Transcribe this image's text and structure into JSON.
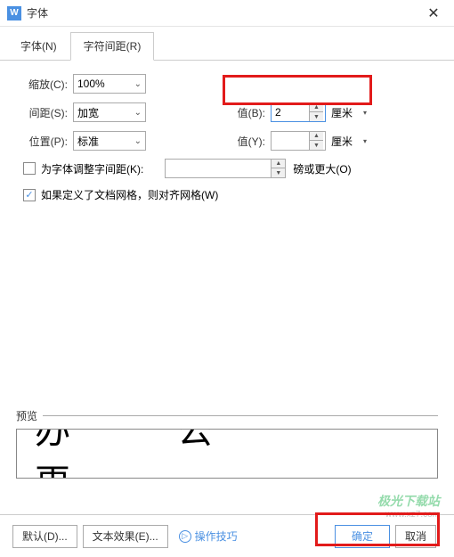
{
  "title": "字体",
  "tabs": {
    "font": "字体(N)",
    "spacing": "字符间距(R)"
  },
  "rows": {
    "scale": {
      "label": "缩放(C):",
      "value": "100%"
    },
    "spacing": {
      "label": "间距(S):",
      "value": "加宽",
      "val_label": "值(B):",
      "val": "2",
      "unit": "厘米"
    },
    "position": {
      "label": "位置(P):",
      "value": "标准",
      "val_label": "值(Y):",
      "val": "",
      "unit": "厘米"
    }
  },
  "kerning": {
    "label": "为字体调整字间距(K):",
    "unit": "磅或更大(O)"
  },
  "snapgrid": {
    "label": "如果定义了文档网格，则对齐网格(W)",
    "checked": true
  },
  "preview": {
    "label": "预览",
    "text": "办公更"
  },
  "buttons": {
    "default": "默认(D)...",
    "effects": "文本效果(E)...",
    "tips": "操作技巧",
    "ok": "确定",
    "cancel": "取消"
  },
  "watermark": {
    "line1": "极光下载站",
    "line2": "www.xz7.com"
  }
}
